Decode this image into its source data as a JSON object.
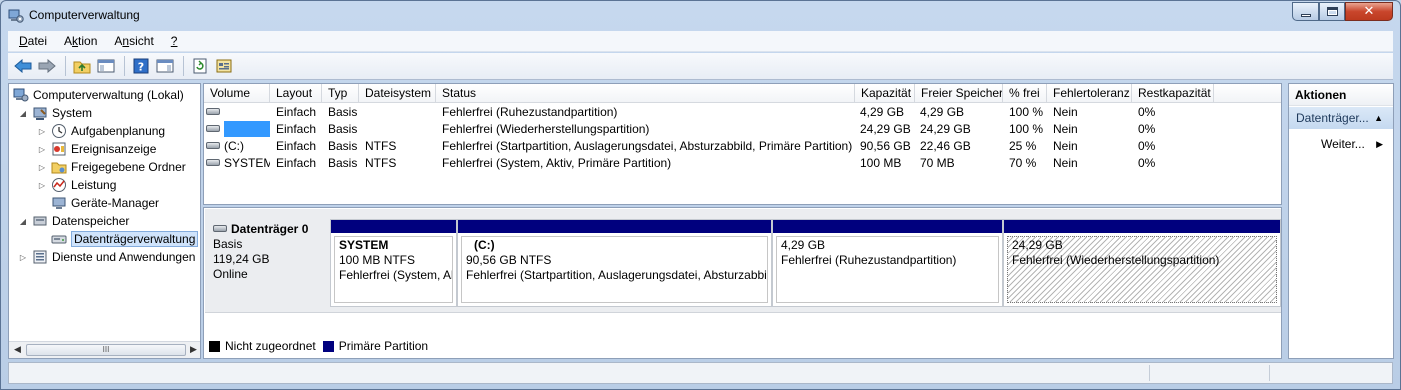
{
  "window": {
    "title": "Computerverwaltung"
  },
  "menu": {
    "items": [
      {
        "label": "Datei",
        "mnemonic": "D",
        "rest": "atei"
      },
      {
        "label": "Aktion",
        "mnemonic": "k",
        "pre": "A",
        "rest": "tion"
      },
      {
        "label": "Ansicht",
        "mnemonic": "n",
        "pre": "A",
        "rest": "sicht"
      },
      {
        "label": "?",
        "mnemonic": "?",
        "rest": ""
      }
    ]
  },
  "tree": {
    "root": "Computerverwaltung (Lokal)",
    "system": "System",
    "aufgabenplanung": "Aufgabenplanung",
    "ereignisanzeige": "Ereignisanzeige",
    "freigegebene_ordner": "Freigegebene Ordner",
    "leistung": "Leistung",
    "geraete_manager": "Geräte-Manager",
    "datenspeicher": "Datenspeicher",
    "datentraegerverwaltung": "Datenträgerverwaltung",
    "dienste": "Dienste und Anwendungen"
  },
  "volumes": {
    "columns": [
      "Volume",
      "Layout",
      "Typ",
      "Dateisystem",
      "Status",
      "Kapazität",
      "Freier Speicher",
      "% frei",
      "Fehlertoleranz",
      "Restkapazität"
    ],
    "rows": [
      {
        "volume": "",
        "layout": "Einfach",
        "typ": "Basis",
        "fs": "",
        "status": "Fehlerfrei (Ruhezustandpartition)",
        "kap": "4,29 GB",
        "frei": "4,29 GB",
        "pct": "100 %",
        "ft": "Nein",
        "rest": "0%"
      },
      {
        "volume": "",
        "layout": "Einfach",
        "typ": "Basis",
        "fs": "",
        "status": "Fehlerfrei (Wiederherstellungspartition)",
        "kap": "24,29 GB",
        "frei": "24,29 GB",
        "pct": "100 %",
        "ft": "Nein",
        "rest": "0%"
      },
      {
        "volume": "(C:)",
        "layout": "Einfach",
        "typ": "Basis",
        "fs": "NTFS",
        "status": "Fehlerfrei (Startpartition, Auslagerungsdatei, Absturzabbild, Primäre Partition)",
        "kap": "90,56 GB",
        "frei": "22,46 GB",
        "pct": "25 %",
        "ft": "Nein",
        "rest": "0%"
      },
      {
        "volume": "SYSTEM",
        "layout": "Einfach",
        "typ": "Basis",
        "fs": "NTFS",
        "status": "Fehlerfrei (System, Aktiv, Primäre Partition)",
        "kap": "100 MB",
        "frei": "70 MB",
        "pct": "70 %",
        "ft": "Nein",
        "rest": "0%"
      }
    ]
  },
  "disk": {
    "name": "Datenträger 0",
    "type": "Basis",
    "size": "119,24 GB",
    "state": "Online",
    "partitions": [
      {
        "name": "SYSTEM",
        "size": "100 MB NTFS",
        "status": "Fehlerfrei (System, Aktiv, Primäre Partition)"
      },
      {
        "name": "(C:)",
        "size": "90,56 GB NTFS",
        "status": "Fehlerfrei (Startpartition, Auslagerungsdatei, Absturzabbild, Primäre Partition)"
      },
      {
        "name": "",
        "size": "4,29 GB",
        "status": "Fehlerfrei (Ruhezustandpartition)"
      },
      {
        "name": "",
        "size": "24,29 GB",
        "status": "Fehlerfrei (Wiederherstellungspartition)"
      }
    ]
  },
  "legend": {
    "unallocated": "Nicht zugeordnet",
    "primary": "Primäre Partition",
    "unallocated_color": "#000000",
    "primary_color": "#00007e"
  },
  "actions": {
    "title": "Aktionen",
    "section": "Datenträger...",
    "more": "Weiter..."
  },
  "colors": {
    "selection": "#3399ff",
    "partition_bar": "#00007e"
  }
}
